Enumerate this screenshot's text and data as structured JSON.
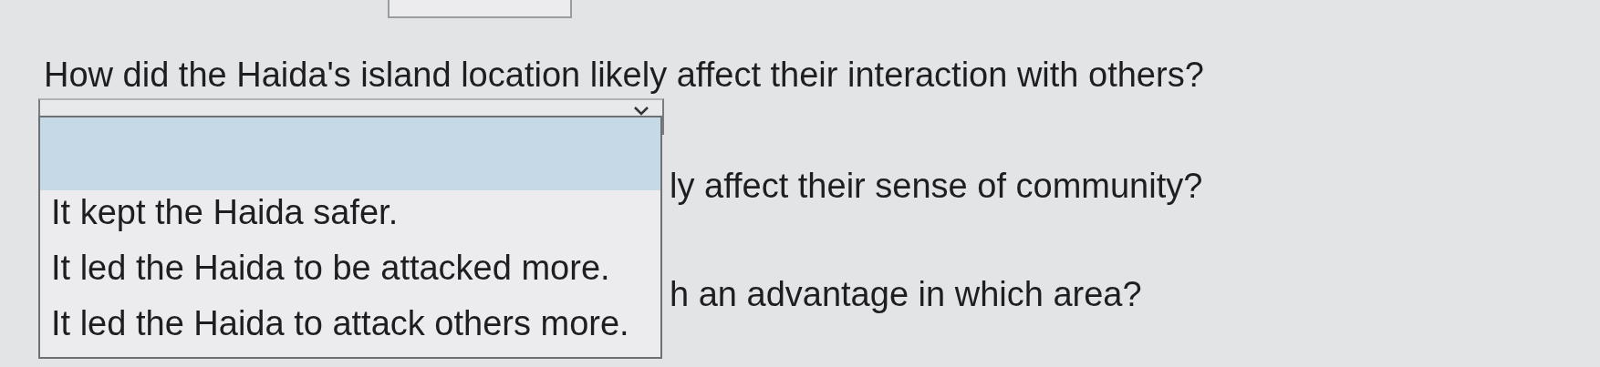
{
  "question": "How did the Haida's island location likely affect their interaction with others?",
  "dropdown": {
    "expanded": true,
    "blank_option_highlighted": true,
    "options": [
      {
        "label": "It kept the Haida safer.",
        "selected": false
      },
      {
        "label": "It led the Haida to be attacked more.",
        "selected": false
      },
      {
        "label": "It led the Haida to attack others more.",
        "selected": false
      }
    ]
  },
  "background_questions": [
    "ly affect their sense of community?",
    "h an advantage in which area?"
  ]
}
